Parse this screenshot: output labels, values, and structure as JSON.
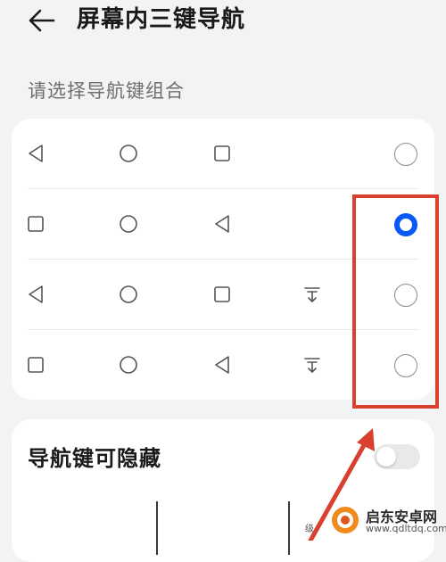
{
  "header": {
    "title": "屏幕内三键导航",
    "back_icon": "arrow-left-icon"
  },
  "section_label": "请选择导航键组合",
  "options": [
    {
      "icons": [
        "triangle-back-icon",
        "circle-home-icon",
        "square-recent-icon"
      ],
      "selected": false
    },
    {
      "icons": [
        "square-recent-icon",
        "circle-home-icon",
        "triangle-back-icon"
      ],
      "selected": true
    },
    {
      "icons": [
        "triangle-back-icon",
        "circle-home-icon",
        "square-recent-icon",
        "notification-pulldown-icon"
      ],
      "selected": false
    },
    {
      "icons": [
        "square-recent-icon",
        "circle-home-icon",
        "triangle-back-icon",
        "notification-pulldown-icon"
      ],
      "selected": false
    }
  ],
  "hide_toggle": {
    "label": "导航键可隐藏",
    "on": false
  },
  "watermark": {
    "name": "启东安卓网",
    "url": "www.qdltdq.com",
    "small_text": "级"
  },
  "colors": {
    "accent": "#0a59f7",
    "annotation": "#d9402f",
    "background": "#f1f3f5"
  }
}
